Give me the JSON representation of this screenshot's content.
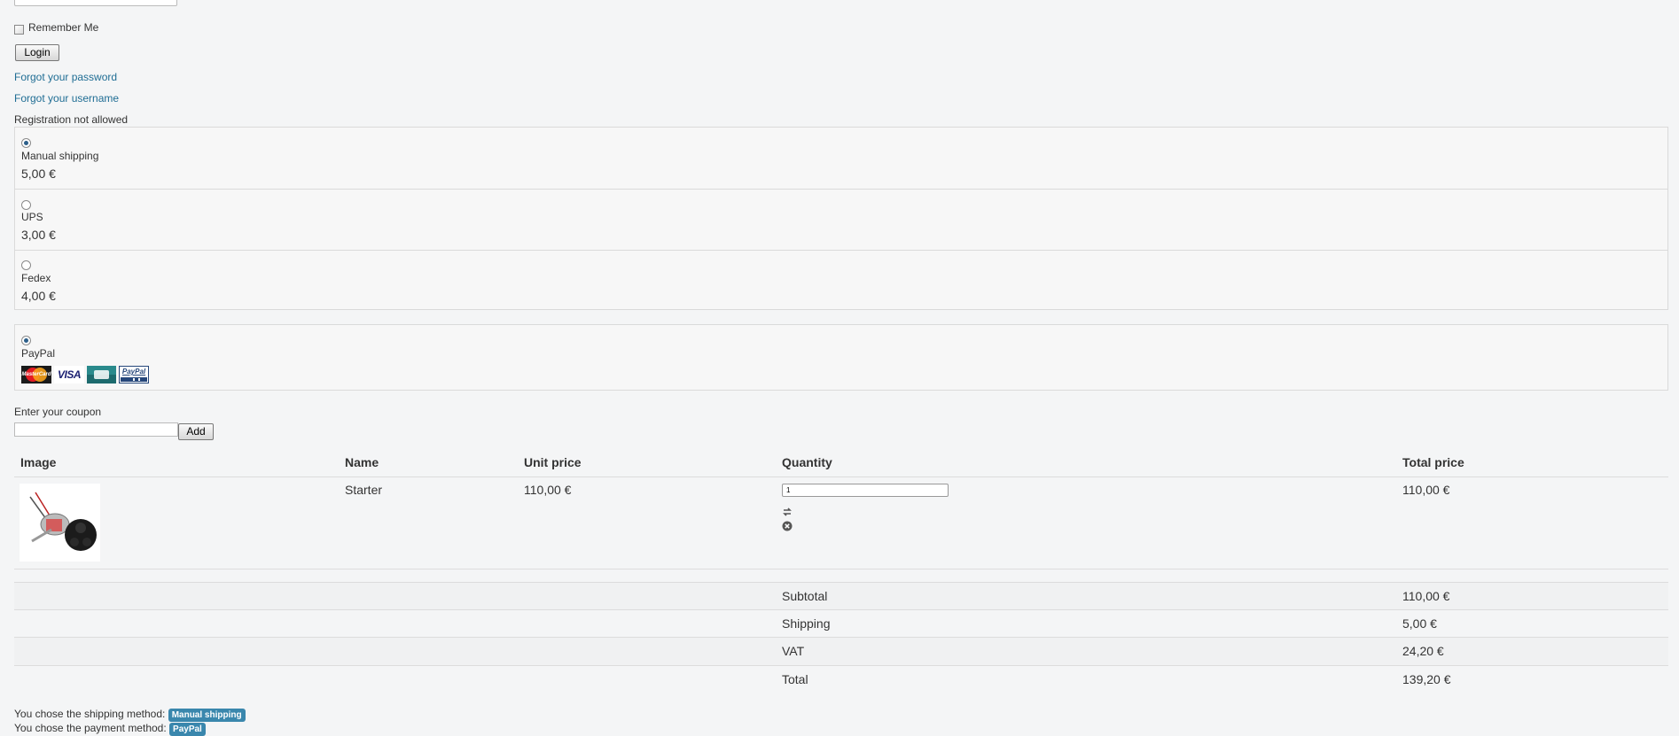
{
  "login": {
    "remember_label": "Remember Me",
    "login_button": "Login",
    "forgot_password": "Forgot your password",
    "forgot_username": "Forgot your username",
    "registration_note": "Registration not allowed"
  },
  "shipping": {
    "options": [
      {
        "name": "Manual shipping",
        "price": "5,00 €",
        "selected": true
      },
      {
        "name": "UPS",
        "price": "3,00 €",
        "selected": false
      },
      {
        "name": "Fedex",
        "price": "4,00 €",
        "selected": false
      }
    ]
  },
  "payment": {
    "options": [
      {
        "name": "PayPal",
        "selected": true
      }
    ],
    "card_icons": [
      "mastercard-icon",
      "visa-icon",
      "cb-icon",
      "paypal-icon"
    ],
    "card_labels": {
      "mastercard": "MasterCard",
      "visa": "VISA",
      "paypal": "PayPal"
    }
  },
  "coupon": {
    "label": "Enter your coupon",
    "value": "",
    "add_button": "Add"
  },
  "cart": {
    "headers": {
      "image": "Image",
      "name": "Name",
      "unit_price": "Unit price",
      "quantity": "Quantity",
      "total_price": "Total price"
    },
    "items": [
      {
        "name": "Starter",
        "unit_price": "110,00 €",
        "quantity": "1",
        "total_price": "110,00 €"
      }
    ],
    "summary": [
      {
        "label": "Subtotal",
        "value": "110,00 €"
      },
      {
        "label": "Shipping",
        "value": "5,00 €"
      },
      {
        "label": "VAT",
        "value": "24,20 €"
      },
      {
        "label": "Total",
        "value": "139,20 €"
      }
    ]
  },
  "footer": {
    "shipping_chosen_text": "You chose the shipping method:",
    "shipping_chosen_badge": "Manual shipping",
    "payment_chosen_text": "You chose the payment method:",
    "payment_chosen_badge": "PayPal"
  },
  "colors": {
    "link": "#1f6d94",
    "badge": "#3a87ad",
    "background": "#f4f5f6"
  }
}
